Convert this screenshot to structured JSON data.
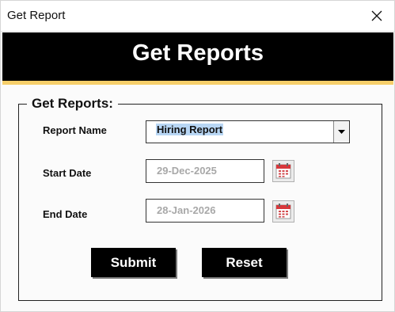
{
  "window": {
    "title": "Get Report"
  },
  "banner": {
    "title": "Get Reports"
  },
  "group": {
    "legend": "Get Reports:"
  },
  "form": {
    "report_name_label": "Report Name",
    "report_name_value": "Hiring Report",
    "start_date_label": "Start Date",
    "start_date_value": "29-Dec-2025",
    "end_date_label": "End Date",
    "end_date_value": "28-Jan-2026"
  },
  "buttons": {
    "submit": "Submit",
    "reset": "Reset"
  },
  "icons": {
    "close": "close-icon",
    "dropdown": "chevron-down-icon",
    "calendar": "calendar-icon"
  },
  "colors": {
    "banner_bg": "#000000",
    "banner_accent": "#f6cf6a",
    "selection": "#b8d6f4"
  }
}
